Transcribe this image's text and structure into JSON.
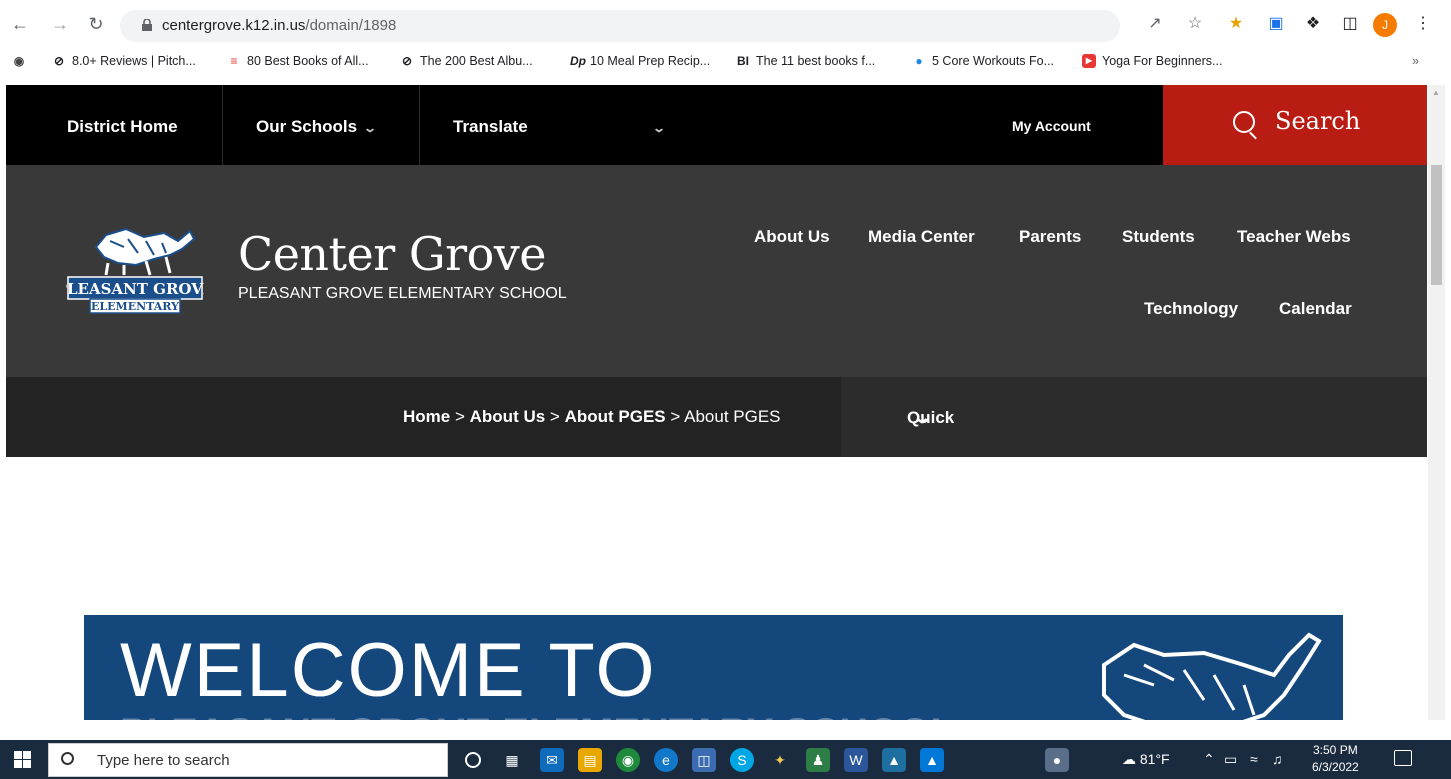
{
  "browser": {
    "url_host": "centergrove.k12.in.us",
    "url_path": "/domain/1898",
    "profile_initial": "J",
    "bookmarks": [
      {
        "icon": "globe-icon",
        "label": ""
      },
      {
        "icon": "pitchfork-icon",
        "label": "8.0+ Reviews | Pitch..."
      },
      {
        "icon": "books-icon",
        "label": "80 Best Books of All..."
      },
      {
        "icon": "pitchfork-icon",
        "label": "The 200 Best Albu..."
      },
      {
        "icon": "mealprep-icon",
        "label": "10 Meal Prep Recip..."
      },
      {
        "icon": "bi-icon",
        "label": "The 11 best books f..."
      },
      {
        "icon": "workout-icon",
        "label": "5 Core Workouts Fo..."
      },
      {
        "icon": "youtube-icon",
        "label": "Yoga For Beginners..."
      }
    ],
    "bookmarks_overflow": "»"
  },
  "topnav": {
    "district_home": "District Home",
    "our_schools": "Our Schools",
    "translate": "Translate",
    "my_account": "My Account",
    "search": "Search"
  },
  "header": {
    "title": "Center Grove",
    "subtitle": "PLEASANT GROVE ELEMENTARY SCHOOL",
    "logo_line1": "PLEASANT GROVE",
    "logo_line2": "ELEMENTARY",
    "nav": [
      "About Us",
      "Media Center",
      "Parents",
      "Students",
      "Teacher Webs",
      "Technology",
      "Calendar"
    ]
  },
  "breadcrumb": {
    "items": [
      "Home",
      "About Us",
      "About PGES"
    ],
    "current": "About PGES",
    "separator": ">",
    "quick_links": "Quick Links"
  },
  "banner": {
    "heading": "WELCOME TO",
    "subheading": "PLEASANT GROVE ELEMENTARY SCHOOL"
  },
  "taskbar": {
    "search_placeholder": "Type here to search",
    "weather": "81°F",
    "time": "3:50 PM",
    "date": "6/3/2022"
  },
  "colors": {
    "search_red": "#b91c12",
    "banner_blue": "#14477c",
    "header_gray": "#393939"
  }
}
